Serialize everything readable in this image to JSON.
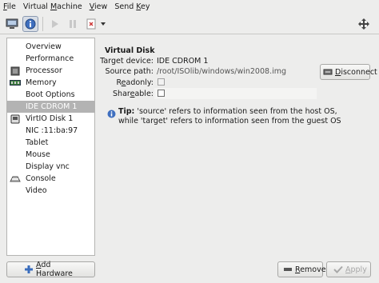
{
  "menu": {
    "items": [
      {
        "label": "File",
        "accel": "F",
        "rest": "ile"
      },
      {
        "label": "Virtual Machine",
        "pre": "Virtual ",
        "accel": "M",
        "rest": "achine"
      },
      {
        "label": "View",
        "accel": "V",
        "rest": "iew"
      },
      {
        "label": "Send Key",
        "pre": "Send ",
        "accel": "K",
        "rest": "ey"
      }
    ]
  },
  "toolbar": {
    "icons": [
      "console-icon",
      "info-icon",
      "run-icon",
      "pause-icon",
      "shutdown-icon",
      "dropdown-arrow-icon",
      "fullscreen-icon"
    ],
    "active": "info-icon"
  },
  "sidebar": {
    "items": [
      {
        "label": "Overview",
        "icon": "none"
      },
      {
        "label": "Performance",
        "icon": "none"
      },
      {
        "label": "Processor",
        "icon": "processor-icon"
      },
      {
        "label": "Memory",
        "icon": "memory-icon"
      },
      {
        "label": "Boot Options",
        "icon": "none"
      },
      {
        "label": "IDE CDROM 1",
        "icon": "none",
        "selected": true
      },
      {
        "label": "VirtIO Disk 1",
        "icon": "disk-icon"
      },
      {
        "label": "NIC :11:ba:97",
        "icon": "none"
      },
      {
        "label": "Tablet",
        "icon": "none"
      },
      {
        "label": "Mouse",
        "icon": "none"
      },
      {
        "label": "Display vnc",
        "icon": "none"
      },
      {
        "label": "Console",
        "icon": "console-device-icon"
      },
      {
        "label": "Video",
        "icon": "none"
      }
    ],
    "add_hardware": {
      "accel": "A",
      "rest": "dd Hardware"
    }
  },
  "details": {
    "title": "Virtual Disk",
    "target_device_label": "Target device:",
    "target_device_value": "IDE CDROM 1",
    "source_path_label": "Source path:",
    "source_path_value": "/root/ISOlib/windows/win2008.img",
    "readonly_pre": "R",
    "readonly_accel": "e",
    "readonly_rest": "adonly:",
    "readonly_checked": false,
    "shareable_pre": "Shar",
    "shareable_accel": "e",
    "shareable_rest": "able:",
    "shareable_checked": false,
    "disconnect": {
      "accel": "D",
      "rest": "isconnect"
    },
    "tip_label": "Tip:",
    "tip_line1": " 'source' refers to information seen from the host OS,",
    "tip_line2": "while 'target' refers to information seen from the guest OS"
  },
  "footer": {
    "remove": {
      "accel": "R",
      "rest": "emove"
    },
    "apply": {
      "accel": "A",
      "rest": "pply",
      "enabled": false
    }
  }
}
